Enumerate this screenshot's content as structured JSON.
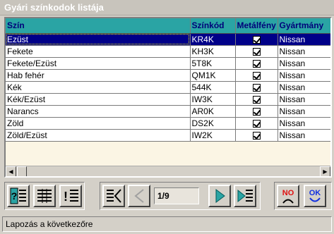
{
  "window": {
    "title": "Gyári színkodok listája"
  },
  "table": {
    "columns": [
      "Szín",
      "Színkód",
      "Metálfény",
      "Gyártmány"
    ],
    "rows": [
      {
        "szin": "Ezüst",
        "kod": "KR4K",
        "metal": true,
        "gyartmany": "Nissan",
        "selected": true
      },
      {
        "szin": "Fekete",
        "kod": "KH3K",
        "metal": true,
        "gyartmany": "Nissan"
      },
      {
        "szin": "Fekete/Ezüst",
        "kod": "5T8K",
        "metal": true,
        "gyartmany": "Nissan"
      },
      {
        "szin": "Hab fehér",
        "kod": "QM1K",
        "metal": true,
        "gyartmany": "Nissan"
      },
      {
        "szin": "Kék",
        "kod": "544K",
        "metal": true,
        "gyartmany": "Nissan"
      },
      {
        "szin": "Kék/Ezüst",
        "kod": "IW3K",
        "metal": true,
        "gyartmany": "Nissan"
      },
      {
        "szin": "Narancs",
        "kod": "AR0K",
        "metal": true,
        "gyartmany": "Nissan"
      },
      {
        "szin": "Zöld",
        "kod": "DS2K",
        "metal": true,
        "gyartmany": "Nissan"
      },
      {
        "szin": "Zöld/Ezüst",
        "kod": "IW2K",
        "metal": true,
        "gyartmany": "Nissan"
      }
    ]
  },
  "navigation": {
    "page_indicator": "1/9"
  },
  "buttons": {
    "no_label": "NO",
    "ok_label": "OK"
  },
  "status": {
    "text": "Lapozás a következőre"
  },
  "colors": {
    "header_bg": "#2aa4a4",
    "header_text": "#00007a",
    "selection_bg": "#000088",
    "grid_bg": "#fbf5e4",
    "face": "#d4d0c8"
  }
}
